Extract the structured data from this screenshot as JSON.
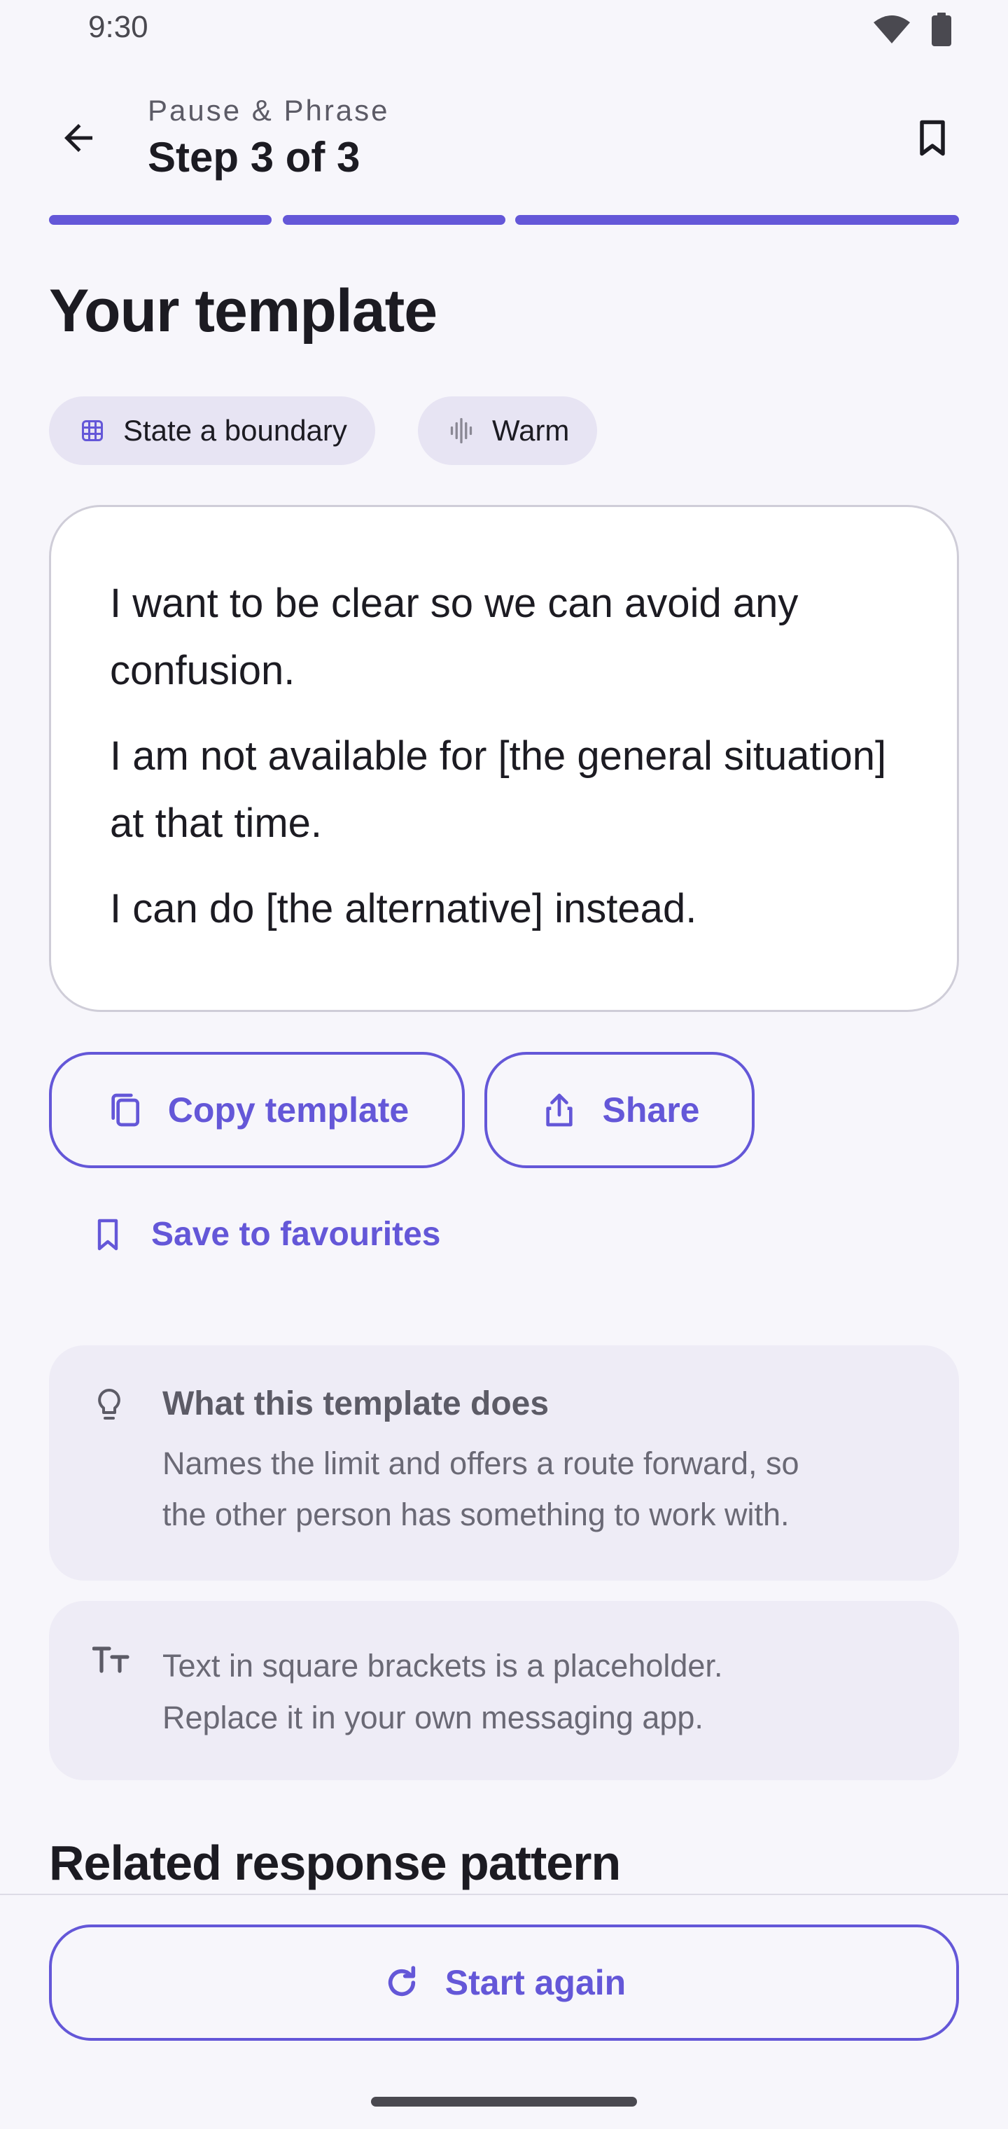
{
  "status_bar": {
    "time": "9:30",
    "icons": [
      "wifi-icon",
      "battery-icon"
    ]
  },
  "app_bar": {
    "subtitle": "Pause & Phrase",
    "title": "Step 3 of 3",
    "back_icon": "arrow-left-icon",
    "bookmark_icon": "bookmark-icon"
  },
  "progress": {
    "current_step": 3,
    "total_steps": 3
  },
  "main": {
    "heading": "Your template",
    "chips": [
      {
        "label": "State a boundary",
        "icon": "grid-icon"
      },
      {
        "label": "Warm",
        "icon": "waveform-icon"
      }
    ],
    "template_lines": [
      "I want to be clear so we can avoid any confusion.",
      "I am not available for [the general situation] at that time.",
      "I can do [the alternative] instead."
    ],
    "actions": {
      "copy_label": "Copy template",
      "share_label": "Share",
      "save_label": "Save to favourites"
    },
    "info_what": {
      "title": "What this template does",
      "line1": "Names the limit and offers a route forward, so",
      "line2": "the other person has something to work with."
    },
    "info_placeholder": {
      "line1": "Text in square brackets is a placeholder.",
      "line2": "Replace it in your own messaging app."
    },
    "related_heading": "Related response pattern"
  },
  "bottom_bar": {
    "start_again_label": "Start again"
  },
  "colors": {
    "accent": "#6457d8",
    "background": "#f7f6fb",
    "chip": "#e7e4f3",
    "info_card": "#eeecf6"
  }
}
